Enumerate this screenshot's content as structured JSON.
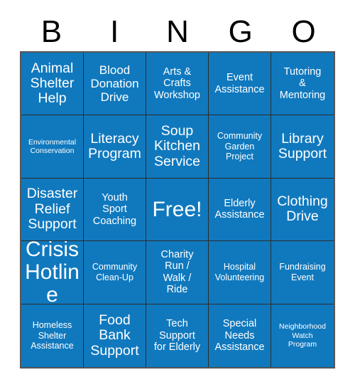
{
  "card": {
    "title": "BINGO",
    "accent_color": "#1079be",
    "text_color": "#ffffff",
    "border_color": "#555555",
    "grid_line_color": "#2b2b2b",
    "header_text_color": "#000000",
    "columns": 5,
    "rows": 5
  },
  "header": {
    "letters": [
      "B",
      "I",
      "N",
      "G",
      "O"
    ]
  },
  "grid": {
    "cells": [
      {
        "text": "Animal\nShelter\nHelp",
        "size": "fs-xl",
        "free": false
      },
      {
        "text": "Blood\nDonation\nDrive",
        "size": "fs-l",
        "free": false
      },
      {
        "text": "Arts &\nCrafts\nWorkshop",
        "size": "fs-m",
        "free": false
      },
      {
        "text": "Event\nAssistance",
        "size": "fs-m",
        "free": false
      },
      {
        "text": "Tutoring\n&\nMentoring",
        "size": "fs-m",
        "free": false
      },
      {
        "text": "Environmental\nConservation",
        "size": "fs-xs",
        "free": false
      },
      {
        "text": "Literacy\nProgram",
        "size": "fs-xl",
        "free": false
      },
      {
        "text": "Soup\nKitchen\nService",
        "size": "fs-xl",
        "free": false
      },
      {
        "text": "Community\nGarden\nProject",
        "size": "fs-s",
        "free": false
      },
      {
        "text": "Library\nSupport",
        "size": "fs-xl",
        "free": false
      },
      {
        "text": "Disaster\nRelief\nSupport",
        "size": "fs-xl",
        "free": false
      },
      {
        "text": "Youth\nSport\nCoaching",
        "size": "fs-m",
        "free": false
      },
      {
        "text": "Free!",
        "size": "fs-xxl",
        "free": true
      },
      {
        "text": "Elderly\nAssistance",
        "size": "fs-m",
        "free": false
      },
      {
        "text": "Clothing\nDrive",
        "size": "fs-xl",
        "free": false
      },
      {
        "text": "Crisis\nHotline",
        "size": "fs-xxl",
        "free": false
      },
      {
        "text": "Community\nClean-Up",
        "size": "fs-s",
        "free": false
      },
      {
        "text": "Charity\nRun /\nWalk /\nRide",
        "size": "fs-m",
        "free": false
      },
      {
        "text": "Hospital\nVolunteering",
        "size": "fs-s",
        "free": false
      },
      {
        "text": "Fundraising\nEvent",
        "size": "fs-s",
        "free": false
      },
      {
        "text": "Homeless\nShelter\nAssistance",
        "size": "fs-s",
        "free": false
      },
      {
        "text": "Food\nBank\nSupport",
        "size": "fs-xl",
        "free": false
      },
      {
        "text": "Tech\nSupport\nfor Elderly",
        "size": "fs-m",
        "free": false
      },
      {
        "text": "Special\nNeeds\nAssistance",
        "size": "fs-m",
        "free": false
      },
      {
        "text": "Neighborhood\nWatch\nProgram",
        "size": "fs-xs",
        "free": false
      }
    ]
  }
}
